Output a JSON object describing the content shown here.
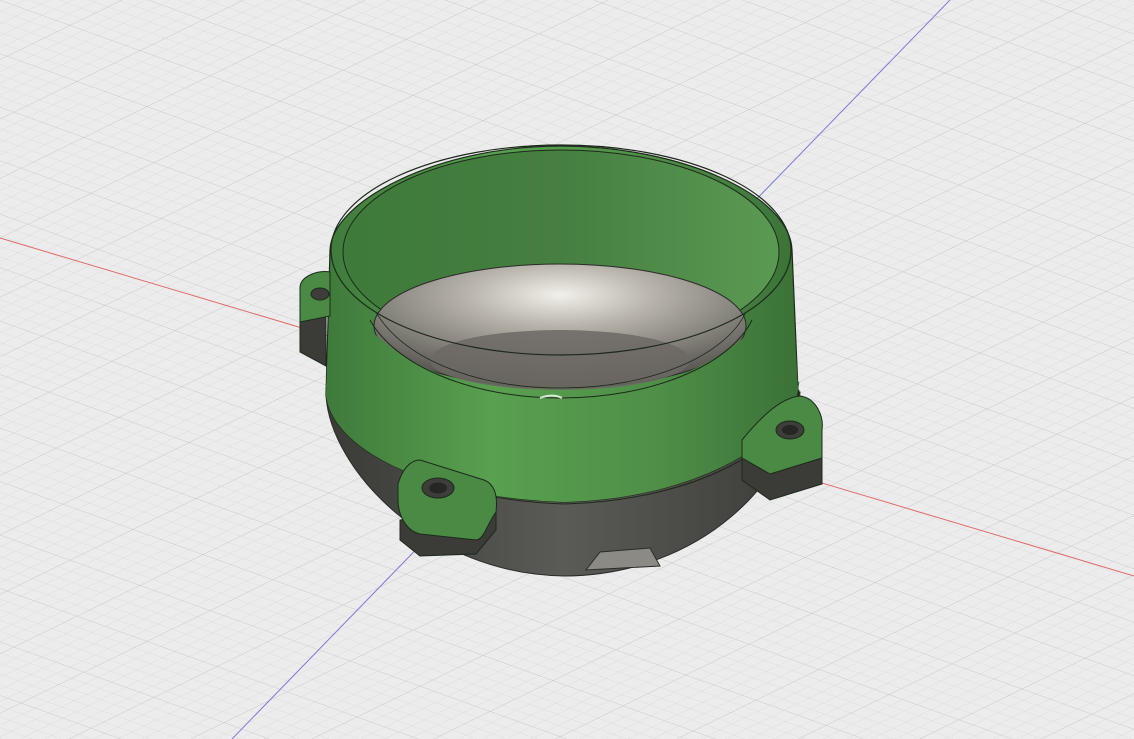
{
  "viewport": {
    "background": "#ececec",
    "grid_minor_color": "#d9d9d9",
    "grid_major_color": "#c6c6c6"
  },
  "axes": {
    "x_axis_color": "#e06a6a",
    "y_axis_color": "#7b7bdc"
  },
  "model": {
    "body_color": "#4a8a45",
    "body_highlight": "#5aa052",
    "body_shadow": "#3a6f37",
    "base_color": "#4f4f4b",
    "inner_metal_light": "#d9d6cf",
    "inner_metal_dark": "#6f6c66",
    "edge_color": "#1c2a1a",
    "mounting_tab_count": 3
  }
}
